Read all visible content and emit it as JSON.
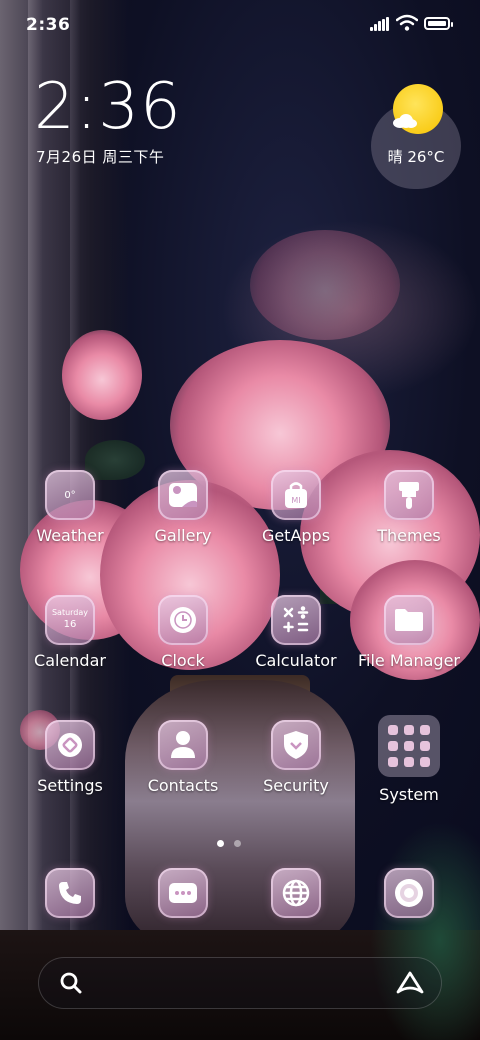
{
  "status_bar": {
    "time": "2:36"
  },
  "clock_widget": {
    "time": "2:36",
    "date": "7月26日 周三下午"
  },
  "weather_widget": {
    "text": "晴 26°C"
  },
  "apps": [
    {
      "label": "Weather",
      "icon_text": "0°",
      "icon": "weather-icon"
    },
    {
      "label": "Gallery",
      "icon": "gallery-icon"
    },
    {
      "label": "GetApps",
      "icon": "getapps-icon",
      "icon_text": "MI"
    },
    {
      "label": "Themes",
      "icon": "themes-icon"
    },
    {
      "label": "Calendar",
      "icon": "calendar-icon",
      "icon_text": "Saturday",
      "icon_text2": "16"
    },
    {
      "label": "Clock",
      "icon": "clock-icon"
    },
    {
      "label": "Calculator",
      "icon": "calculator-icon"
    },
    {
      "label": "File Manager",
      "icon": "folder-icon"
    },
    {
      "label": "Settings",
      "icon": "settings-icon"
    },
    {
      "label": "Contacts",
      "icon": "contacts-icon"
    },
    {
      "label": "Security",
      "icon": "shield-icon"
    },
    {
      "label": "System",
      "icon": "system-folder-icon"
    }
  ],
  "dock": [
    {
      "icon": "phone-icon"
    },
    {
      "icon": "messages-icon"
    },
    {
      "icon": "browser-icon"
    },
    {
      "icon": "camera-icon"
    }
  ],
  "page_indicator": {
    "current": 1,
    "total": 2
  },
  "colors": {
    "accent": "#e6b3d6",
    "icon_bg": "#b782b0"
  }
}
